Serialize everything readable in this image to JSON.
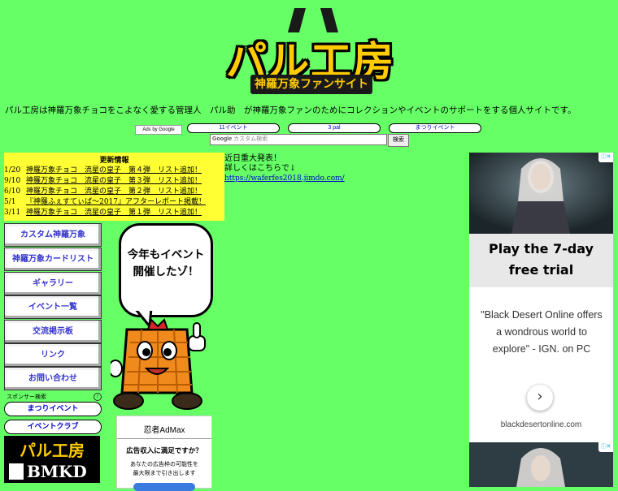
{
  "logo": {
    "main": "パル工房",
    "sub": "神羅万象ファンサイト"
  },
  "intro": "パル工房は神羅万象チョコをこよなく愛する管理人　パル助　が神羅万象ファンのためにコレクションやイベントのサポートをする個人サイトです。",
  "adlinks": {
    "ads_by": "Ads by Google",
    "items": [
      "11イベント",
      "3 pal",
      "まつりイベント"
    ]
  },
  "search": {
    "placeholder": "カスタム検索",
    "button": "検索"
  },
  "updates": {
    "title": "更新情報",
    "items": [
      {
        "date": "1/20",
        "text": "神羅万象チョコ　流星の皇子　第４弾　リスト追加！"
      },
      {
        "date": "9/10",
        "text": "神羅万象チョコ　流星の皇子　第３弾　リスト追加！"
      },
      {
        "date": "6/10",
        "text": "神羅万象チョコ　流星の皇子　第２弾　リスト追加！"
      },
      {
        "date": "5/1",
        "text": "『神羅ふぇすてぃば～2017』アフターレポート掲載！"
      },
      {
        "date": "3/11",
        "text": "神羅万象チョコ　流星の皇子　第１弾　リスト追加！"
      }
    ]
  },
  "announce": {
    "line1": "近日重大発表！",
    "line2": "詳しくはこちらで↓",
    "link": "https://waferfes2018.jimdo.com/"
  },
  "nav": [
    "カスタム神羅万象",
    "神羅万象カードリスト",
    "ギャラリー",
    "イベント一覧",
    "交流掲示板",
    "リンク",
    "お問い合わせ"
  ],
  "sponsor": {
    "label": "スポンサー検索",
    "info": "i",
    "items": [
      "まつりイベント",
      "イベントクラブ"
    ]
  },
  "mini_logo": {
    "top": "パル工房",
    "bottom": "BMKD"
  },
  "bubble": {
    "line1": "今年もイベント",
    "line2": "開催したゾ！"
  },
  "admax": {
    "brand": "忍者AdMax",
    "question": "広告収入に満足ですか？",
    "line1": "あなたの広告枠の可能性を",
    "line2": "最大限まで引き出します"
  },
  "ad_right": {
    "cta_line1": "Play the 7-day",
    "cta_line2": "free trial",
    "quote": "\"Black Desert Online offers a wondrous world to explore\" - IGN. on PC",
    "arrow": "›",
    "domain": "blackdesertonline.com"
  }
}
